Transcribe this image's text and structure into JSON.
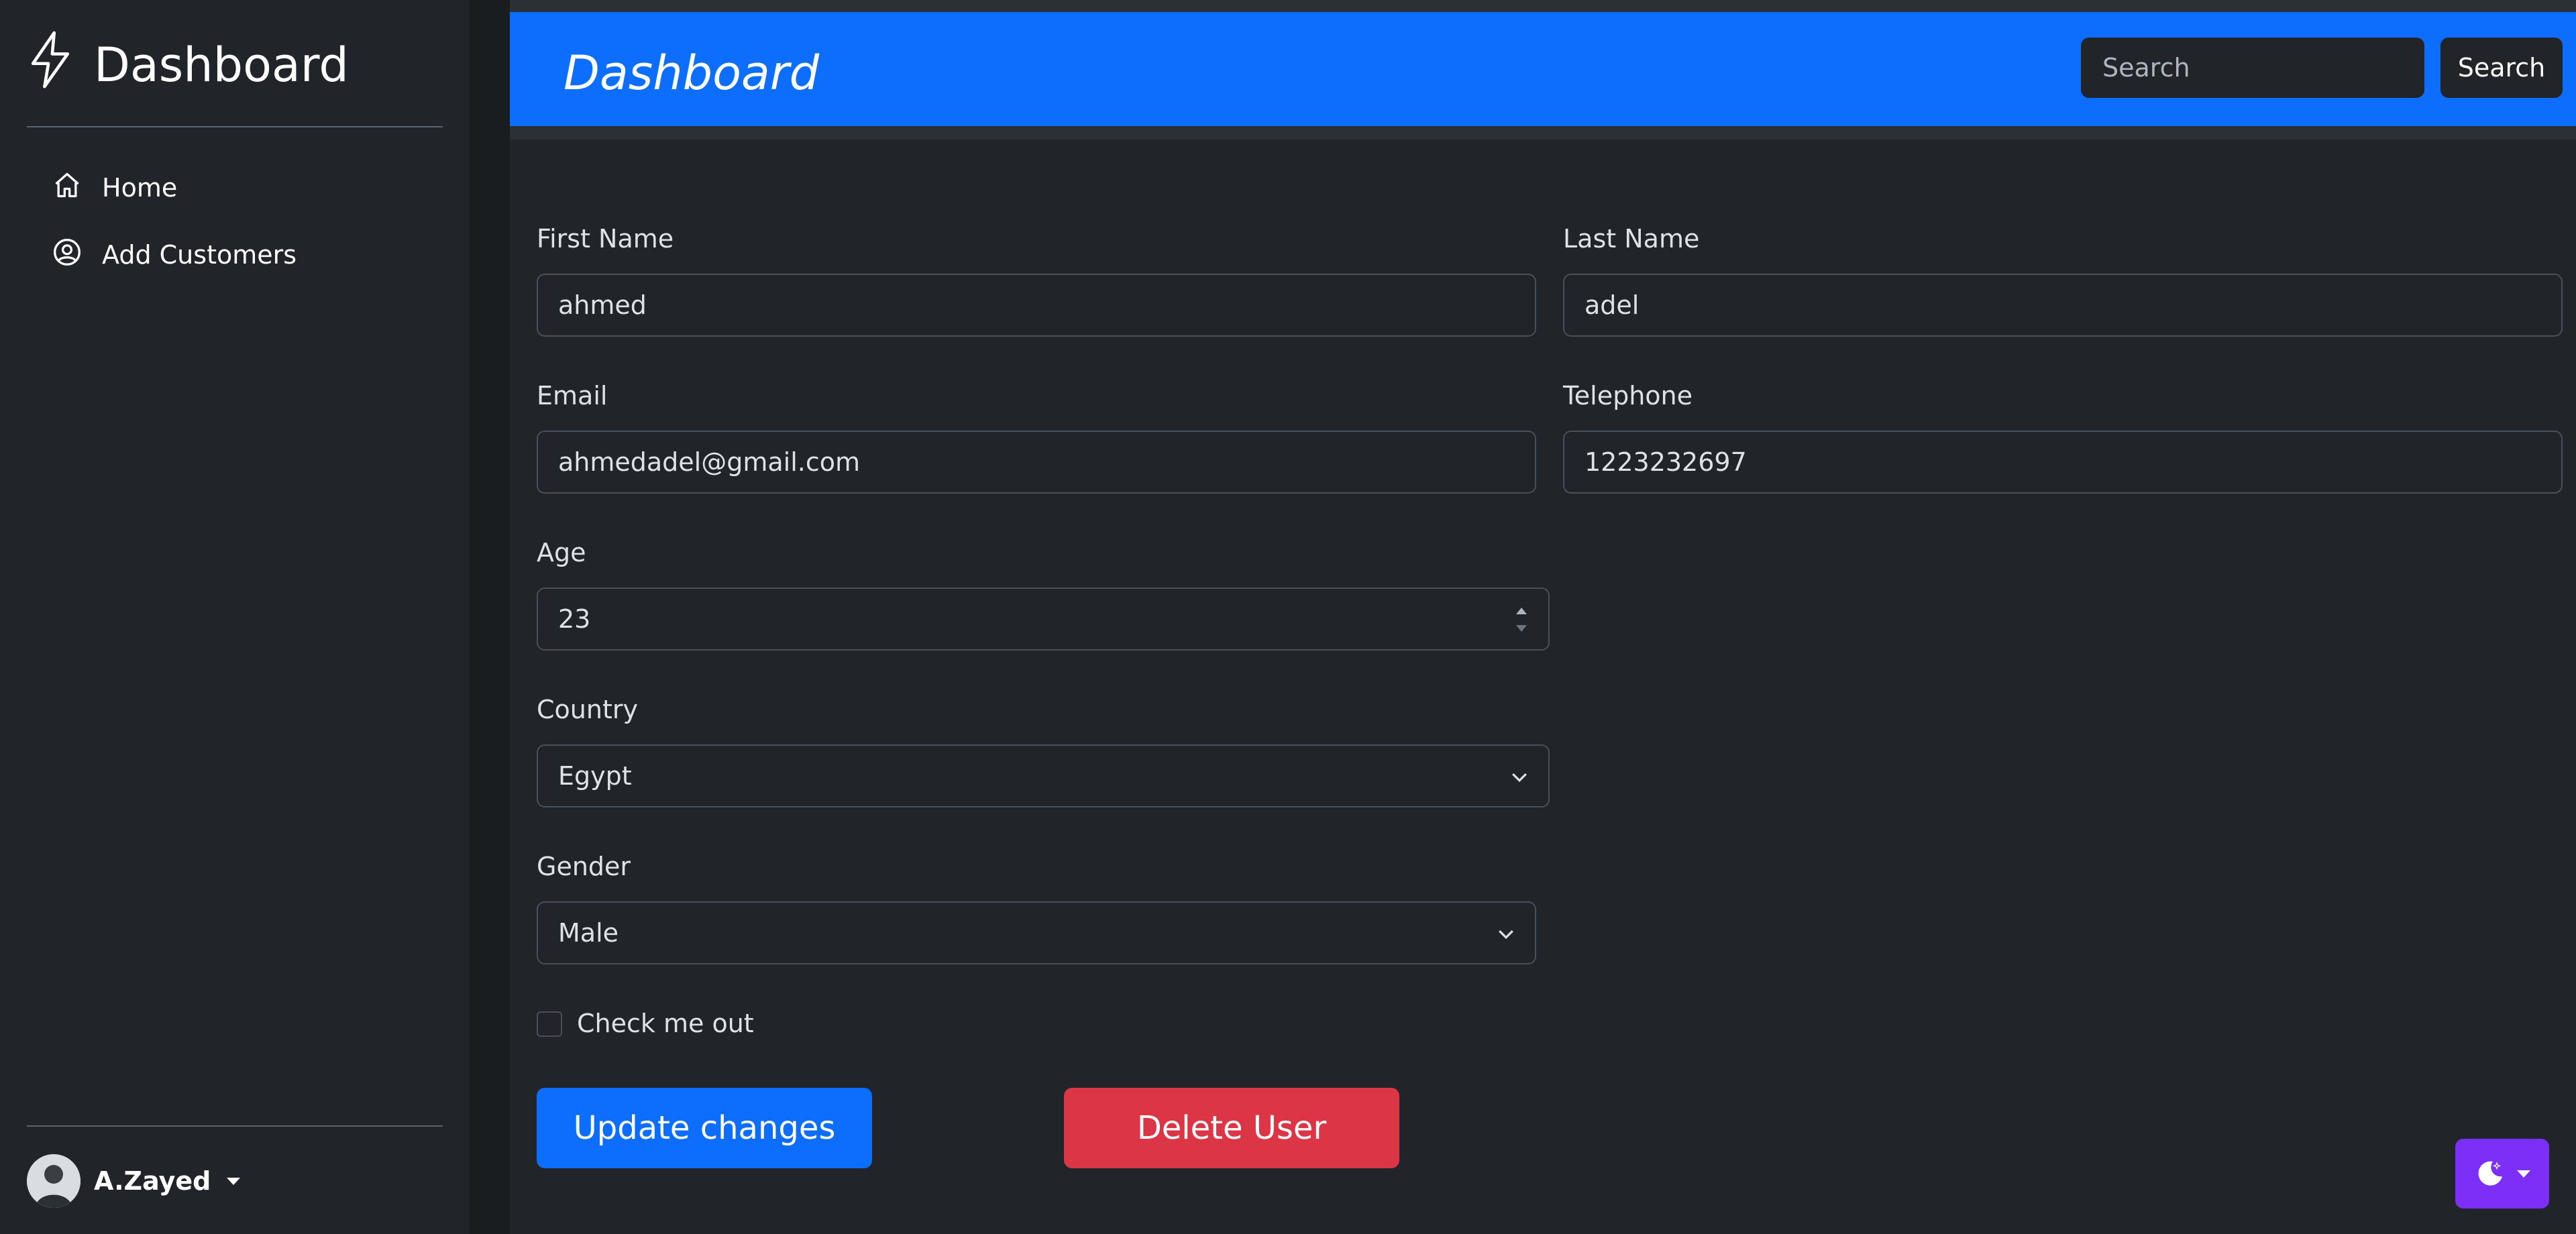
{
  "sidebar": {
    "brand": "Dashboard",
    "items": [
      {
        "label": "Home",
        "icon": "home-icon"
      },
      {
        "label": "Add Customers",
        "icon": "user-circle-icon"
      }
    ],
    "user": {
      "name": "A.Zayed"
    }
  },
  "header": {
    "title": "Dashboard",
    "search_placeholder": "Search",
    "search_button": "Search"
  },
  "form": {
    "first_name": {
      "label": "First Name",
      "value": "ahmed"
    },
    "last_name": {
      "label": "Last Name",
      "value": "adel"
    },
    "email": {
      "label": "Email",
      "value": "ahmedadel@gmail.com"
    },
    "telephone": {
      "label": "Telephone",
      "value": "1223232697"
    },
    "age": {
      "label": "Age",
      "value": "23"
    },
    "country": {
      "label": "Country",
      "value": "Egypt"
    },
    "gender": {
      "label": "Gender",
      "value": "Male"
    },
    "checkbox_label": "Check me out",
    "update_button": "Update changes",
    "delete_button": "Delete User"
  },
  "colors": {
    "primary": "#0d6efd",
    "danger": "#dc3545",
    "theme_toggle": "#7b2ff7",
    "background": "#212529"
  }
}
